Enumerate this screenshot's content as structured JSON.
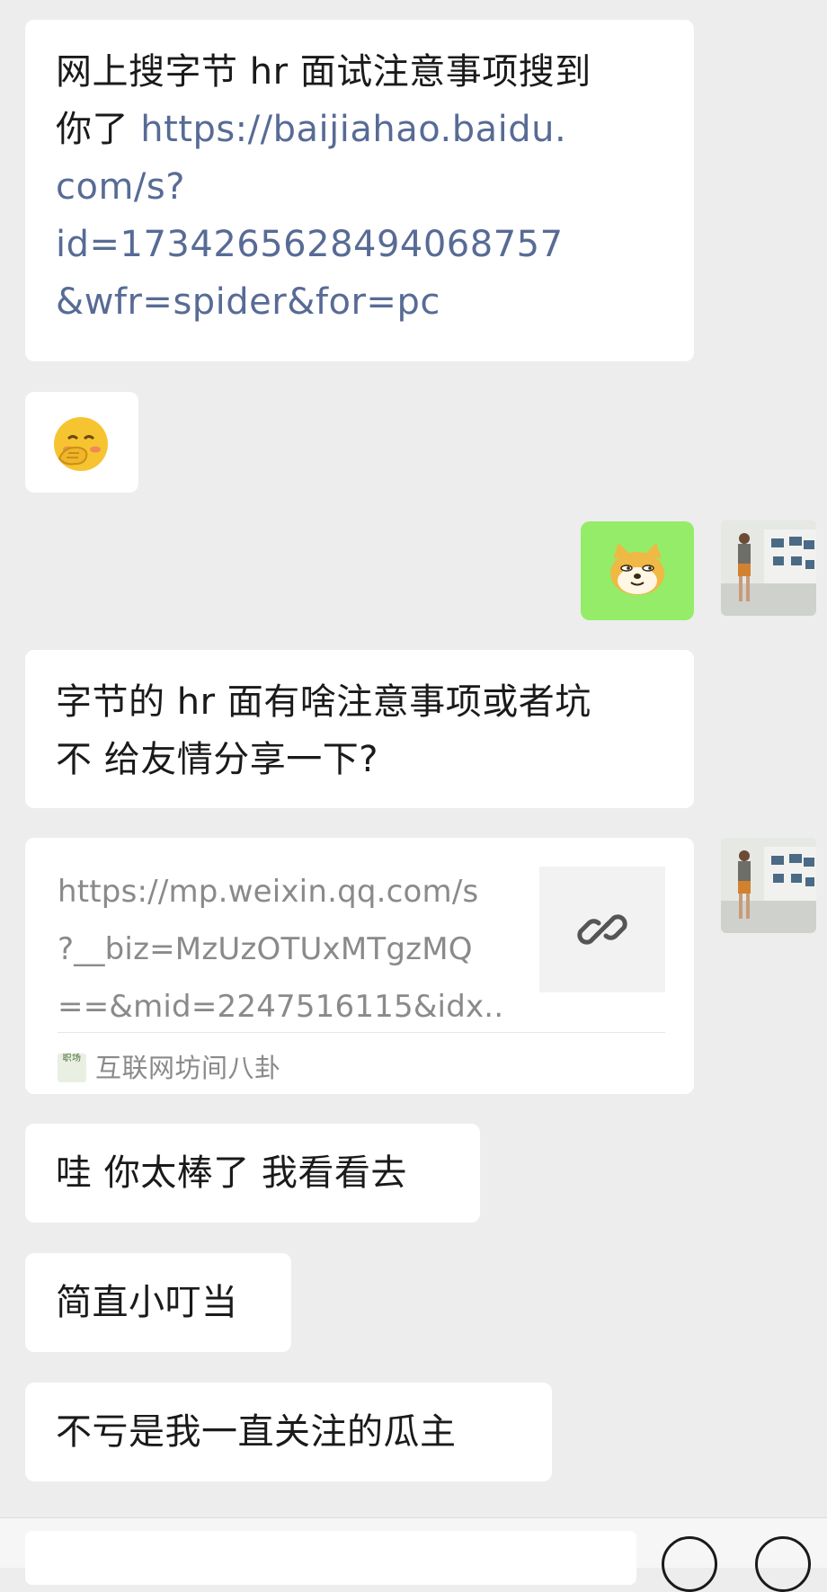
{
  "messages": [
    {
      "sender": "other",
      "text_before": "网上搜字节 hr 面试注意事项搜到你了 ",
      "link": "https://baijiahao.baidu.com/s?id=1734265628494068757&wfr=spider&for=pc",
      "lines": [
        "网上搜字节 hr 面试注意事项搜到",
        "你了 "
      ],
      "link_lines": [
        "https://baijiahao.baidu.",
        "com/s?",
        "id=1734265628494068757",
        "&wfr=spider&for=pc"
      ]
    },
    {
      "sender": "other",
      "emoji": "shy-face-emoji"
    },
    {
      "sender": "me",
      "emoji": "doge-emoji"
    },
    {
      "sender": "other",
      "lines": [
        "字节的 hr 面有啥注意事项或者坑",
        "不 给友情分享一下?"
      ]
    },
    {
      "sender": "me",
      "type": "link-card",
      "url_lines": [
        "https://mp.weixin.qq.com/s",
        "?__biz=MzUzOTUxMTgzMQ",
        "==&mid=2247516115&idx..."
      ],
      "source": "互联网坊间八卦",
      "source_logo_text": "职场"
    },
    {
      "sender": "other",
      "text": "哇 你太棒了 我看看去"
    },
    {
      "sender": "other",
      "text": "简直小叮当"
    },
    {
      "sender": "other",
      "text": "不亏是我一直关注的瓜主"
    }
  ],
  "colors": {
    "background": "#ededed",
    "bubble_other": "#ffffff",
    "bubble_me": "#95ec69",
    "link": "#576b95"
  }
}
